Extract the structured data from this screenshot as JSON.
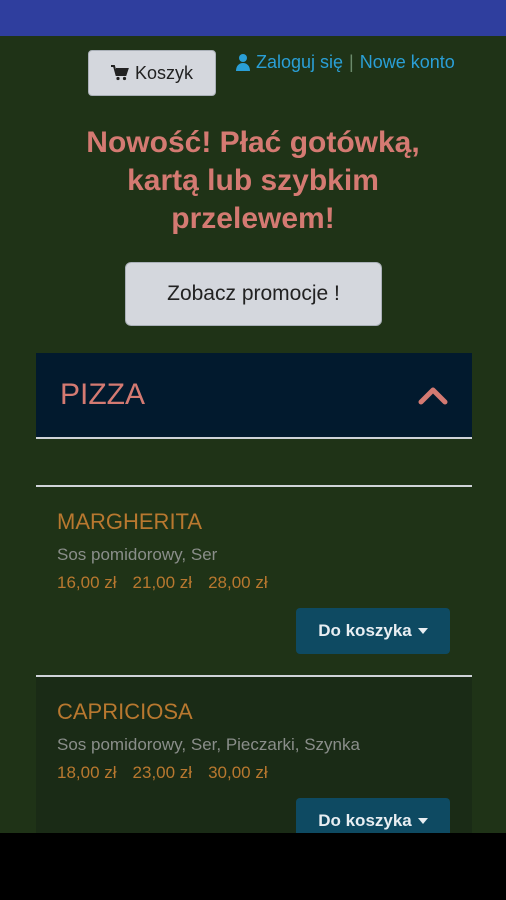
{
  "header": {
    "cart_label": "Koszyk",
    "login_label": "Zaloguj się",
    "separator": "|",
    "register_label": "Nowe konto"
  },
  "promo": {
    "headline_line1": "Nowość! Płać gotówką,",
    "headline_line2": "kartą lub szybkim",
    "headline_line3": "przelewem!",
    "button_label": "Zobacz promocje !"
  },
  "menu": {
    "category": "PIZZA",
    "add_label": "Do koszyka",
    "products": [
      {
        "name": "MARGHERITA",
        "description": "Sos pomidorowy, Ser",
        "prices": [
          "16,00 zł",
          "21,00 zł",
          "28,00 zł"
        ]
      },
      {
        "name": "CAPRICIOSA",
        "description": "Sos pomidorowy, Ser, Pieczarki, Szynka",
        "prices": [
          "18,00 zł",
          "23,00 zł",
          "30,00 zł"
        ]
      }
    ]
  },
  "colors": {
    "status_bar": "#2f3e9e",
    "background": "#1f3317",
    "accent_red": "#d47a72",
    "link_blue": "#2a9fd6",
    "price_orange": "#b8782f",
    "category_bg": "#021a2e",
    "add_button": "#0e4a62"
  },
  "icons": [
    "cart-icon",
    "user-icon",
    "chevron-up-icon",
    "caret-down-icon"
  ]
}
